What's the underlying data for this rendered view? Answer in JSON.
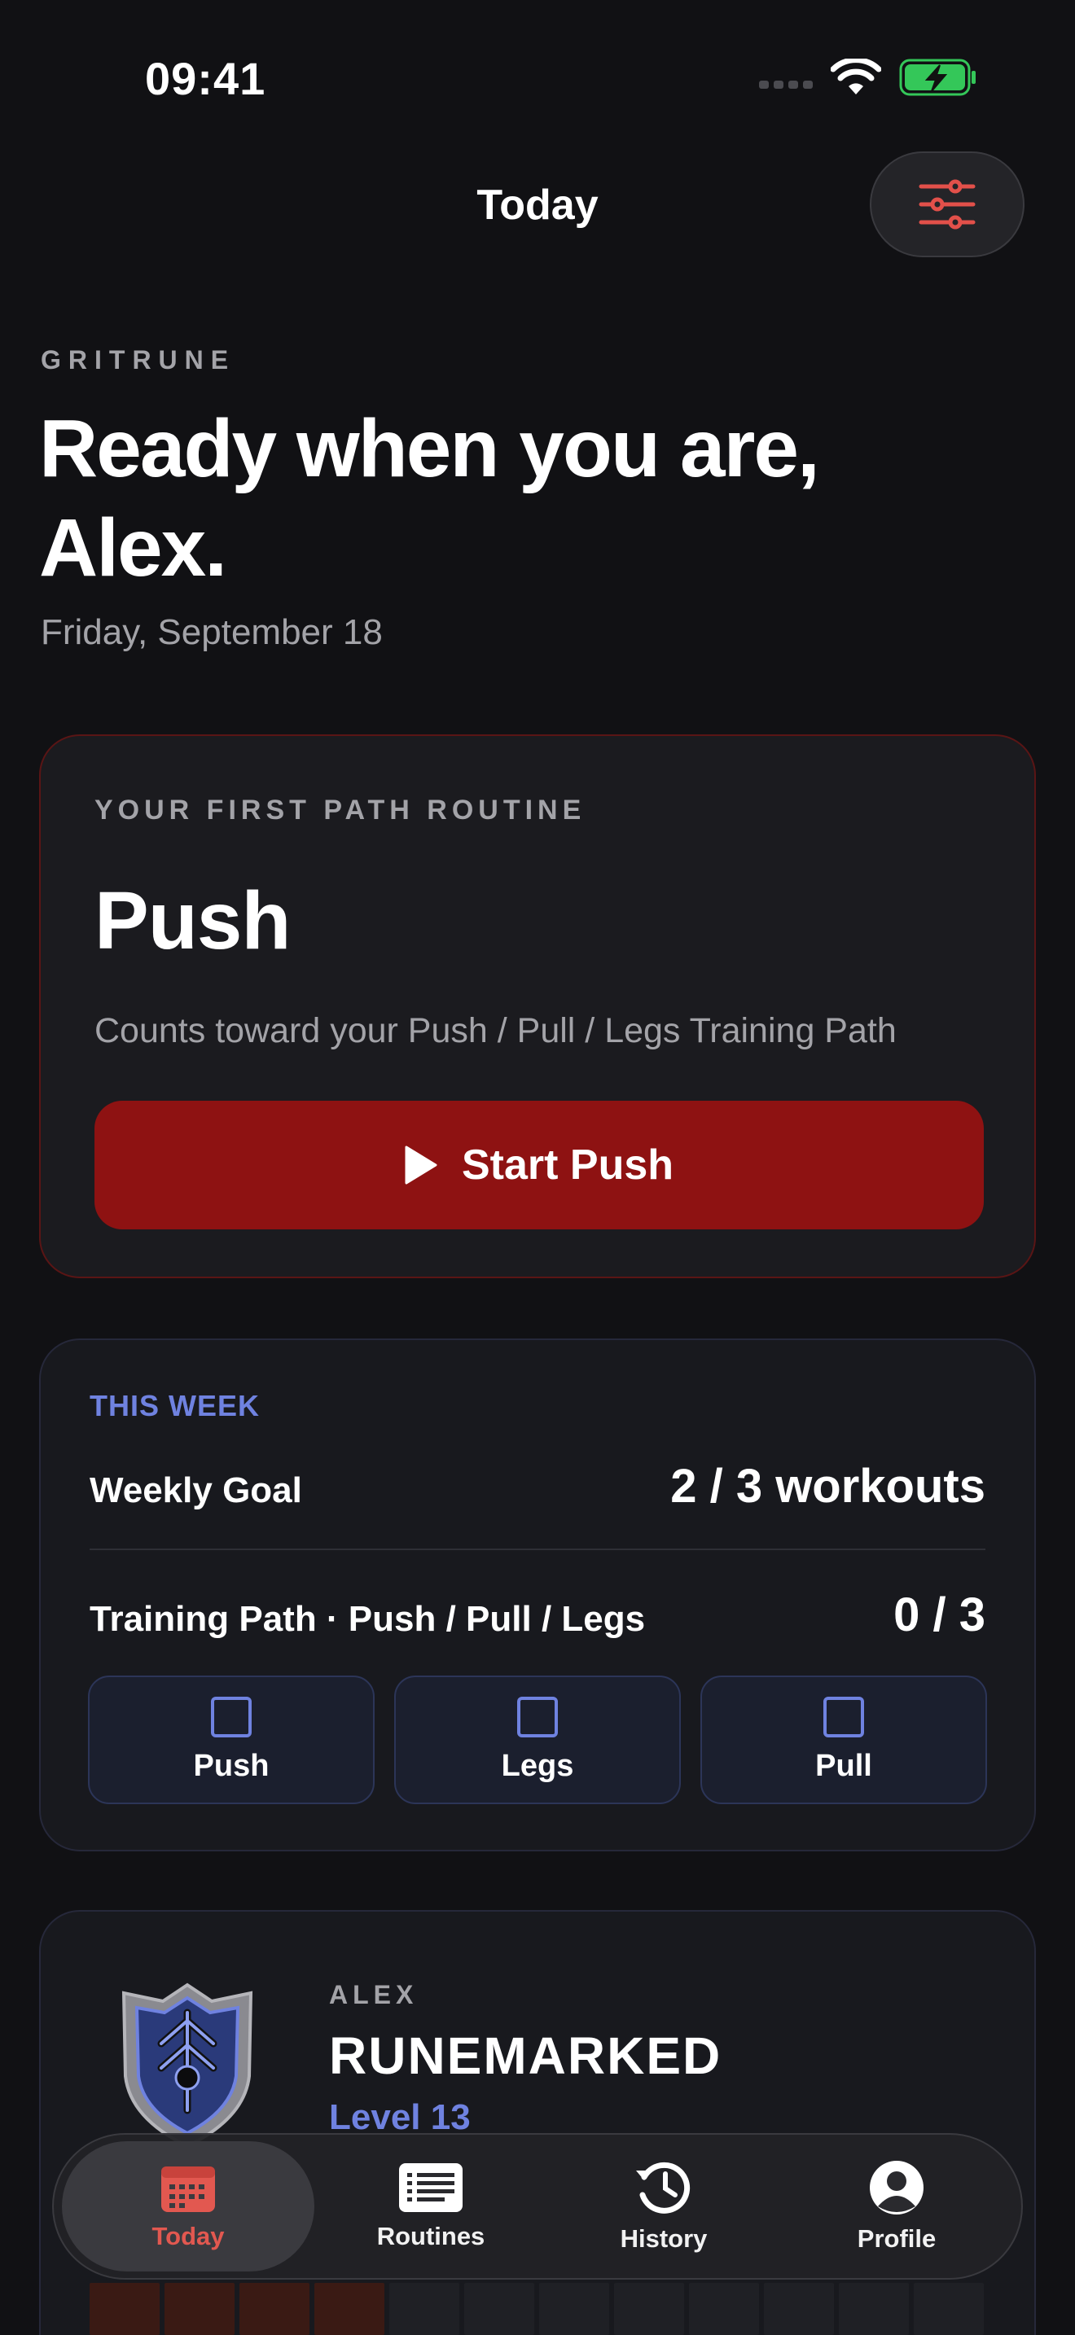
{
  "status_bar": {
    "time": "09:41"
  },
  "nav": {
    "title": "Today"
  },
  "greeting": {
    "brand": "GRITRUNE",
    "headline_line1": "Ready when you are,",
    "headline_line2": "Alex.",
    "date": "Friday, September 18"
  },
  "routine_card": {
    "kicker": "YOUR FIRST PATH ROUTINE",
    "name": "Push",
    "subtitle": "Counts toward your Push / Pull / Legs Training Path",
    "start_label": "Start Push"
  },
  "week_card": {
    "kicker": "THIS WEEK",
    "goal_label": "Weekly Goal",
    "goal_value": "2 / 3 workouts",
    "path_label": "Training Path · Push / Pull / Legs",
    "path_value": "0 / 3",
    "path_items": [
      {
        "label": "Push",
        "done": false
      },
      {
        "label": "Legs",
        "done": false
      },
      {
        "label": "Pull",
        "done": false
      }
    ]
  },
  "profile_card": {
    "user": "ALEX",
    "rank": "RUNEMARKED",
    "level": "Level 13"
  },
  "tabbar": {
    "items": [
      {
        "label": "Today",
        "icon": "calendar-icon",
        "active": true
      },
      {
        "label": "Routines",
        "icon": "list-icon",
        "active": false
      },
      {
        "label": "History",
        "icon": "history-icon",
        "active": false
      },
      {
        "label": "Profile",
        "icon": "person-icon",
        "active": false
      }
    ]
  },
  "colors": {
    "background": "#111114",
    "accent_red": "#8e1212",
    "accent_red_text": "#e25850",
    "accent_blue": "#6f82e0",
    "battery_green": "#34c759"
  }
}
